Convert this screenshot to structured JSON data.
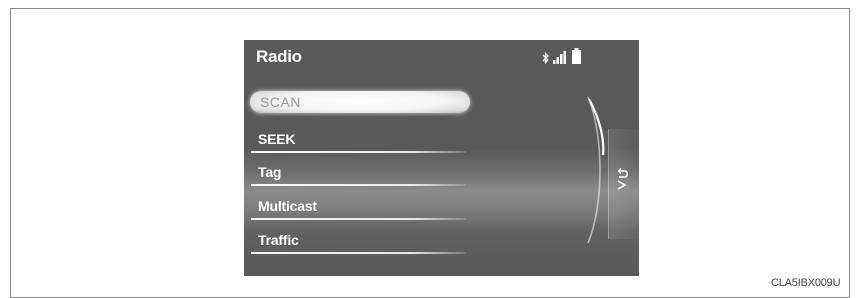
{
  "screen": {
    "title": "Radio",
    "status_icons": [
      "bluetooth-icon",
      "signal-icon",
      "battery-icon"
    ],
    "menu": {
      "selected": "SCAN",
      "items": [
        {
          "label": "SCAN"
        },
        {
          "label": "SEEK"
        },
        {
          "label": "Tag"
        },
        {
          "label": "Multicast"
        },
        {
          "label": "Traffic"
        }
      ]
    },
    "back_icon": "back-arrow-icon"
  },
  "caption": "CLA5IBX009U"
}
